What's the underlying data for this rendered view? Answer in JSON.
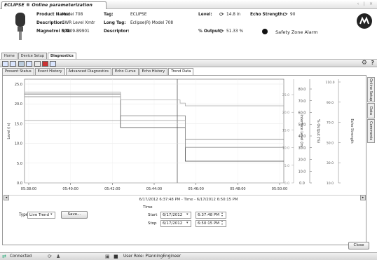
{
  "window": {
    "title": "ECLIPSE ® Online parameterization",
    "controls": "‹ ∣ ×"
  },
  "header": {
    "product_name_label": "Product Name:",
    "product_name": "Model 708",
    "description_label": "Description:",
    "description": "GWR Level Xmtr",
    "mag_sn_label": "Magnetrol S/N:",
    "mag_sn": "d9N09-B9901",
    "tag_label": "Tag:",
    "tag": "ECLIPSE",
    "long_tag_label": "Long Tag:",
    "long_tag": "Eclipse(R) Model 708",
    "descriptor_label": "Descriptor:",
    "descriptor": "",
    "level_label": "Level:",
    "level_value": "14.8 in",
    "echo_label": "Echo Strength:",
    "echo_value": "90",
    "output_label": "% Output:",
    "output_value": "51.33 %",
    "safety_label": "Safety Zone Alarm"
  },
  "tabs_top": [
    "Home",
    "Device Setup",
    "Diagnostics"
  ],
  "tabs_diag": [
    "Present Status",
    "Event History",
    "Advanced Diagnostics",
    "Echo Curve",
    "Echo History",
    "Trend Data"
  ],
  "side_tabs": [
    "Online Setup",
    "Data",
    "Comments"
  ],
  "chart_data": {
    "type": "line",
    "x_ticks": [
      "05:38:00",
      "05:40:00",
      "05:42:00",
      "05:44:00",
      "05:46:00",
      "05:48:00",
      "05:50:00"
    ],
    "caption": "6/17/2012 6:37:48 PM - Time - 6/17/2012 6:50:15 PM",
    "left_axis": {
      "label": "Level (in)",
      "ticks": [
        "25.0",
        "20.0",
        "15.0",
        "10.0",
        "5.0",
        "0.0"
      ]
    },
    "axis2": {
      "label": "Interface Level (in)",
      "ticks": [
        "25.0",
        "20.0",
        "15.0",
        "10.0",
        "5.0",
        "0.0"
      ]
    },
    "axis3": {
      "label": "% Output (%)",
      "ticks": [
        "80.0",
        "70.0",
        "60.0",
        "50.0",
        "40.0",
        "30.0",
        "20.0",
        "10.0",
        "0.0"
      ]
    },
    "axis4": {
      "label": "Echo Strength",
      "ticks": [
        "110.0",
        "90.0",
        "70.0",
        "50.0",
        "30.0",
        "10.0"
      ]
    },
    "series": [
      {
        "color": "#444444",
        "x": [
          0,
          0.37,
          0.37,
          0.62,
          0.62,
          1.0
        ],
        "y": [
          22.5,
          22.5,
          14.0,
          14.0,
          5.5,
          5.5
        ]
      },
      {
        "color": "#777777",
        "x": [
          0,
          0.37,
          0.37,
          0.62,
          0.62,
          1.0
        ],
        "y": [
          21.8,
          21.8,
          17.0,
          17.0,
          11.0,
          11.0
        ]
      },
      {
        "color": "#999999",
        "x": [
          0,
          0.37,
          0.37,
          0.62,
          0.62,
          1.0
        ],
        "y": [
          15.8,
          15.8,
          15.8,
          15.8,
          9.0,
          9.0
        ]
      },
      {
        "color": "#aaaaaa",
        "x": [
          0,
          0.37,
          0.37,
          0.6,
          0.6,
          0.62,
          0.62,
          1.0
        ],
        "y": [
          23.0,
          23.0,
          21.0,
          21.0,
          20.2,
          20.2,
          19.5,
          19.5
        ]
      }
    ]
  },
  "controls": {
    "type_label": "Type",
    "type_value": "Live Trend",
    "save_label": "Save...",
    "time_label": "Time",
    "start_label": "Start",
    "stop_label": "Stop",
    "start_date": "6/17/2012",
    "start_time": "6:37:48 PM",
    "stop_date": "6/17/2012",
    "stop_time": "6:50:15 PM",
    "close_label": "Close"
  },
  "status": {
    "connected": "Connected",
    "user_role": "User Role: PlanningEngineer"
  }
}
